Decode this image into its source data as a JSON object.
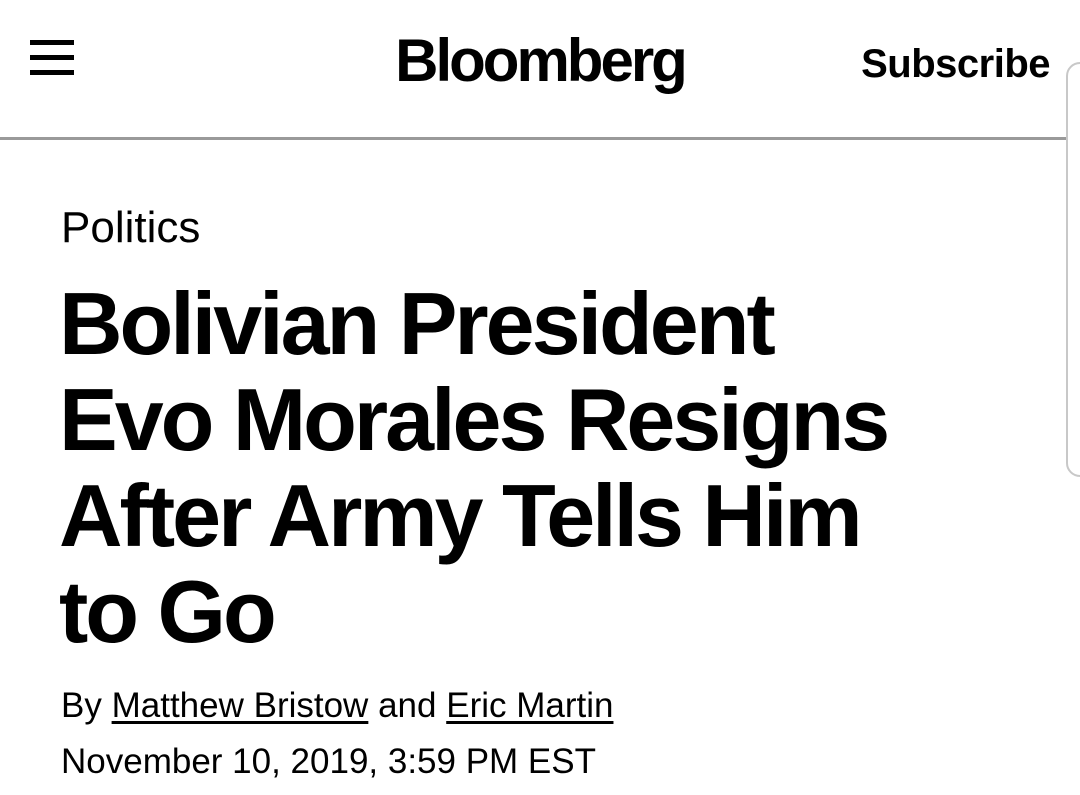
{
  "header": {
    "menu_icon": "hamburger-menu-icon",
    "logo": "Bloomberg",
    "subscribe_label": "Subscribe"
  },
  "article": {
    "section": "Politics",
    "headline_lines": [
      "Bolivian President",
      "Evo Morales Resigns",
      "After Army Tells Him",
      "to Go"
    ],
    "byline": {
      "prefix": "By",
      "author1": "Matthew Bristow",
      "joiner": "and",
      "author2": "Eric Martin"
    },
    "timestamp": "November 10, 2019, 3:59 PM EST"
  }
}
